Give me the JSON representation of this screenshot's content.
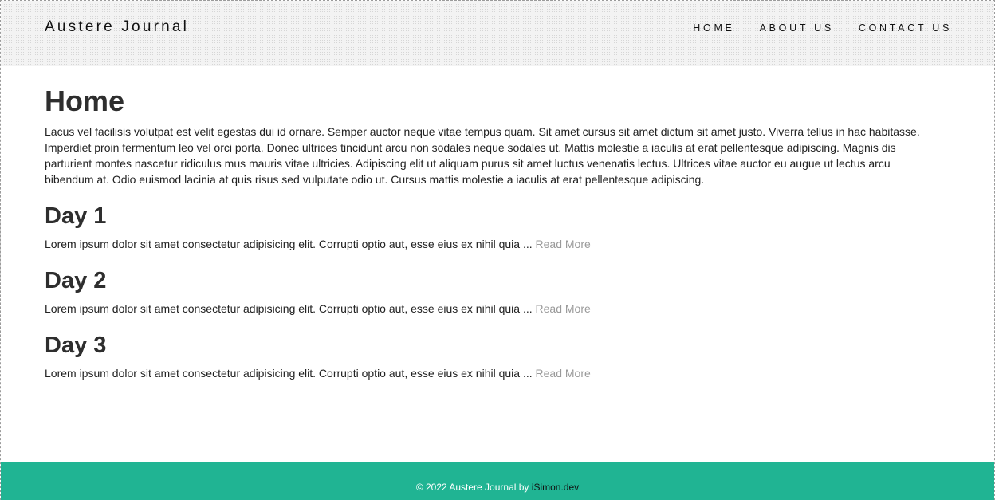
{
  "header": {
    "brand": "Austere Journal",
    "nav": [
      {
        "label": "HOME"
      },
      {
        "label": "ABOUT US"
      },
      {
        "label": "CONTACT US"
      }
    ]
  },
  "main": {
    "title": "Home",
    "intro": "Lacus vel facilisis volutpat est velit egestas dui id ornare. Semper auctor neque vitae tempus quam. Sit amet cursus sit amet dictum sit amet justo. Viverra tellus in hac habitasse. Imperdiet proin fermentum leo vel orci porta. Donec ultrices tincidunt arcu non sodales neque sodales ut. Mattis molestie a iaculis at erat pellentesque adipiscing. Magnis dis parturient montes nascetur ridiculus mus mauris vitae ultricies. Adipiscing elit ut aliquam purus sit amet luctus venenatis lectus. Ultrices vitae auctor eu augue ut lectus arcu bibendum at. Odio euismod lacinia at quis risus sed vulputate odio ut. Cursus mattis molestie a iaculis at erat pellentesque adipiscing.",
    "posts": [
      {
        "title": "Day 1",
        "excerpt": "Lorem ipsum dolor sit amet consectetur adipisicing elit. Corrupti optio aut, esse eius ex nihil quia ...",
        "read_more": "Read More"
      },
      {
        "title": "Day 2",
        "excerpt": "Lorem ipsum dolor sit amet consectetur adipisicing elit. Corrupti optio aut, esse eius ex nihil quia ...",
        "read_more": "Read More"
      },
      {
        "title": "Day 3",
        "excerpt": "Lorem ipsum dolor sit amet consectetur adipisicing elit. Corrupti optio aut, esse eius ex nihil quia ...",
        "read_more": "Read More"
      }
    ]
  },
  "footer": {
    "copyright": "© 2022 Austere Journal by",
    "author_link": "iSimon.dev"
  },
  "colors": {
    "footer_bg": "#20b493",
    "heading": "#2e2e2e",
    "read_more": "#9a9a9a",
    "header_bg": "#f3f3f3"
  }
}
